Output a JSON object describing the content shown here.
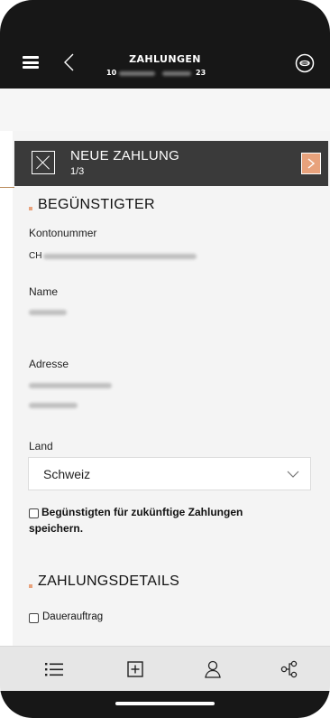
{
  "header": {
    "title": "ZAHLUNGEN",
    "date_start": "10",
    "date_end": "23",
    "menu_icon": "hamburger-menu-icon",
    "back_icon": "chevron-left-icon",
    "coin_icon": "coin-icon"
  },
  "card": {
    "title": "NEUE ZAHLUNG",
    "step": "1/3",
    "close_icon": "close-icon",
    "next_icon": "chevron-right-icon"
  },
  "beneficiary": {
    "section_title": "BEGÜNSTIGTER",
    "account_label": "Kontonummer",
    "account_prefix": "CH",
    "name_label": "Name",
    "address_label": "Adresse",
    "country_label": "Land",
    "country_value": "Schweiz",
    "save_checkbox_label": "Begünstigten für zukünftige Zahlungen speichern."
  },
  "payment_details": {
    "section_title": "ZAHLUNGSDETAILS",
    "standing_order_label": "Dauerauftrag"
  },
  "bottom_nav": {
    "items": [
      {
        "icon": "list-icon"
      },
      {
        "icon": "add-icon"
      },
      {
        "icon": "person-icon"
      },
      {
        "icon": "share-icon"
      }
    ]
  },
  "colors": {
    "accent": "#e8a27c",
    "dark_bar": "#171717",
    "card_header": "#3a3a3a",
    "content_bg": "#f4f4f4"
  }
}
